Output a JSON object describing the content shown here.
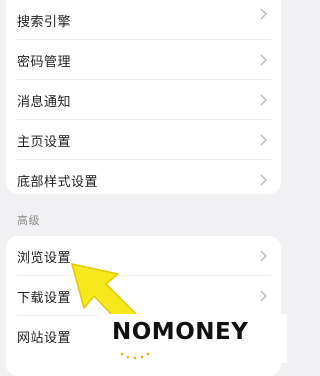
{
  "settings_group": {
    "items": [
      {
        "label": "搜索引擎"
      },
      {
        "label": "密码管理"
      },
      {
        "label": "消息通知"
      },
      {
        "label": "主页设置"
      },
      {
        "label": "底部样式设置"
      }
    ]
  },
  "advanced": {
    "section_label": "高级",
    "items": [
      {
        "label": "浏览设置"
      },
      {
        "label": "下载设置"
      },
      {
        "label": "网站设置"
      }
    ]
  },
  "overlay": {
    "arrow_color": "#f7e81d",
    "watermark": "NOMONEY"
  },
  "icons": {
    "row_chevron": "chevron-right-icon"
  },
  "colors": {
    "background": "#f1f1f3",
    "card": "#ffffff",
    "text": "#1f1f1f",
    "chevron": "#b9b9b9"
  }
}
